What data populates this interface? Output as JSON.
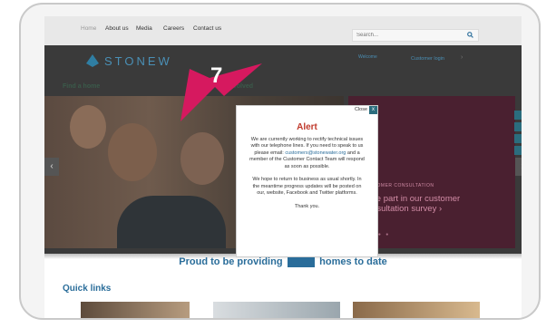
{
  "nav": {
    "items": [
      "Home",
      "About us",
      "Media",
      "Careers",
      "Contact us"
    ],
    "search_placeholder": "Search..."
  },
  "brand": {
    "logo_text": "STONEW",
    "badge_text": "Welcome",
    "customer_link": "Customer login",
    "customer_arrow": "›"
  },
  "sections": {
    "find_home": "Find a home",
    "get_involved": "Get involved"
  },
  "carousel": {
    "prev": "‹",
    "next": "›",
    "promo_small": "CUSTOMER CONSULTATION",
    "promo_big": "Take part in our customer consultation survey ›",
    "promo_dots": "● ● ● ●"
  },
  "banner": {
    "prefix": "Proud to be providing",
    "number": "0000",
    "suffix": "homes to date"
  },
  "quick_links": {
    "title": "Quick links"
  },
  "dialog": {
    "close_label": "Close",
    "close_x": "x",
    "title": "Alert",
    "para1_a": "We are currently working to rectify technical issues with our telephone lines. If you need to speak to us please email:",
    "email": "customers@stonewater.org",
    "para1_b": "and a member of the Customer Contact Team will respond as soon as possible.",
    "para2": "We hope to return to business as usual shortly. In the meantime progress updates will be posted on our, website, Facebook and Twitter platforms.",
    "thanks": "Thank you."
  },
  "callout": {
    "step_number": "7",
    "color": "#d6195f"
  }
}
